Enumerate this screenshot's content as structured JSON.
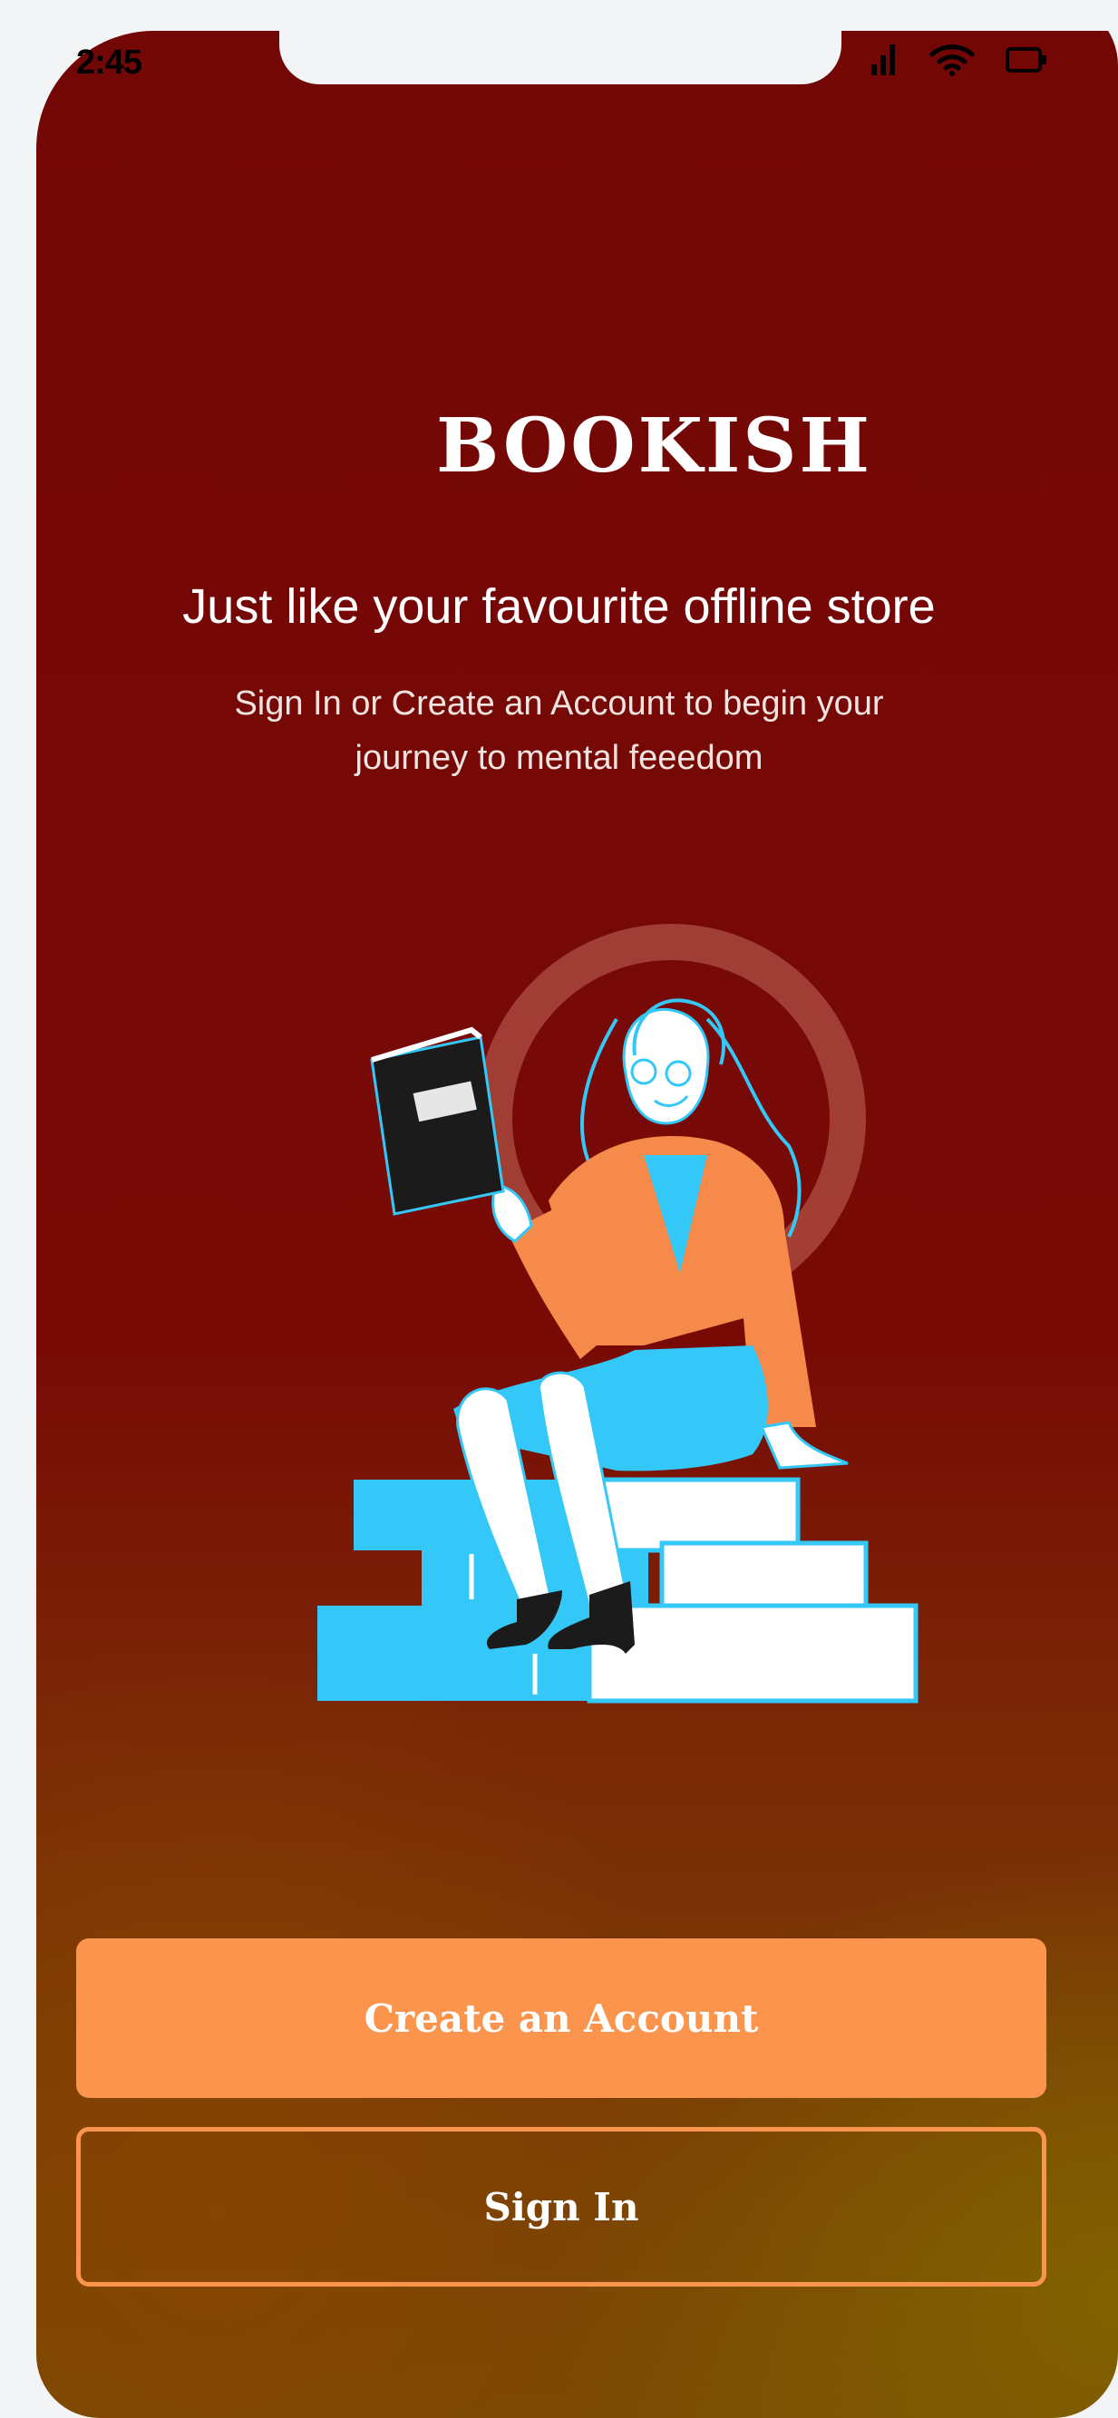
{
  "status_bar": {
    "time": "2:45",
    "icons": [
      "signal-icon",
      "wifi-icon",
      "battery-icon"
    ]
  },
  "app": {
    "logo_text": "BOOKISH",
    "tagline": "Just like your favourite offline store",
    "subtitle": "Sign In or Create an Account to begin  your journey to mental feeedom"
  },
  "actions": {
    "create_account_label": "Create an Account",
    "sign_in_label": "Sign In"
  },
  "colors": {
    "background_top": "#730705",
    "background_bottom": "#7a4a05",
    "accent": "#fb944c",
    "illustration_blue": "#33c8f8",
    "illustration_orange": "#f58a4a"
  },
  "illustration": {
    "name": "woman-reading-on-books-illustration"
  }
}
